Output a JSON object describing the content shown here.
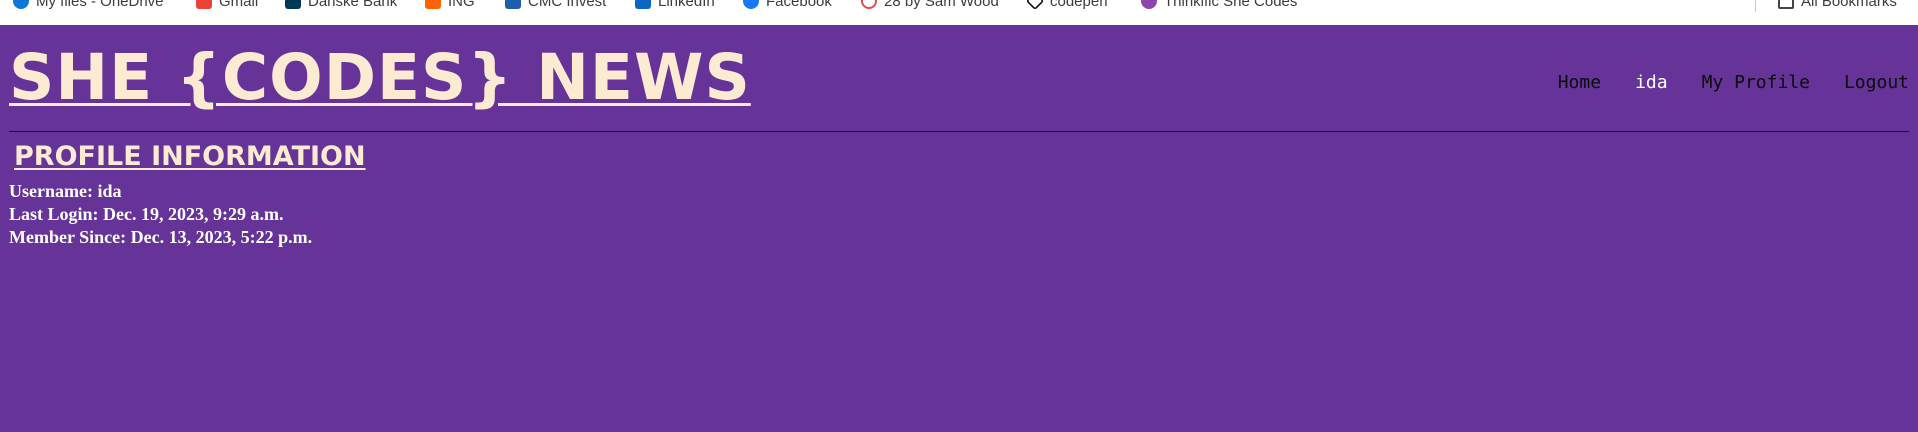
{
  "bookmarks_bar": {
    "items": [
      {
        "label": "My files - OneDrive",
        "icon": "onedrive-icon",
        "color": "#0f78d4"
      },
      {
        "label": "Gmail",
        "icon": "gmail-icon",
        "color": "#ea4335"
      },
      {
        "label": "Danske Bank",
        "icon": "danske-bank-icon",
        "color": "#003755"
      },
      {
        "label": "ING",
        "icon": "ing-lion-icon",
        "color": "#ff6200"
      },
      {
        "label": "CMC Invest",
        "icon": "cmc-invest-icon",
        "color": "#1f5ea8"
      },
      {
        "label": "LinkedIn",
        "icon": "linkedin-icon",
        "color": "#0a66c2"
      },
      {
        "label": "Facebook",
        "icon": "facebook-icon",
        "color": "#1877f2"
      },
      {
        "label": "28 by Sam Wood",
        "icon": "28-by-sam-wood-icon",
        "color": "#e24b4b"
      },
      {
        "label": "codepen",
        "icon": "codepen-icon",
        "color": "#111111"
      },
      {
        "label": "Thinkific She Codes",
        "icon": "thinkific-icon",
        "color": "#8e44ad"
      }
    ],
    "all_bookmarks": {
      "label": "All Bookmarks",
      "icon": "folder-icon"
    }
  },
  "site": {
    "title": "SHE {CODES} NEWS",
    "nav": {
      "home": "Home",
      "user": "ida",
      "my_profile": "My Profile",
      "logout": "Logout"
    }
  },
  "profile": {
    "heading": "PROFILE INFORMATION",
    "username": "Username: ida",
    "last_login": "Last Login: Dec. 19, 2023, 9:29 a.m.",
    "member_since": "Member Since: Dec. 13, 2023, 5:22 p.m."
  },
  "colors": {
    "background": "#663399",
    "title": "#fcebd2",
    "nav_text": "#0b0b0b",
    "nav_active_user": "#ffffff",
    "info_text": "#ffffff"
  }
}
